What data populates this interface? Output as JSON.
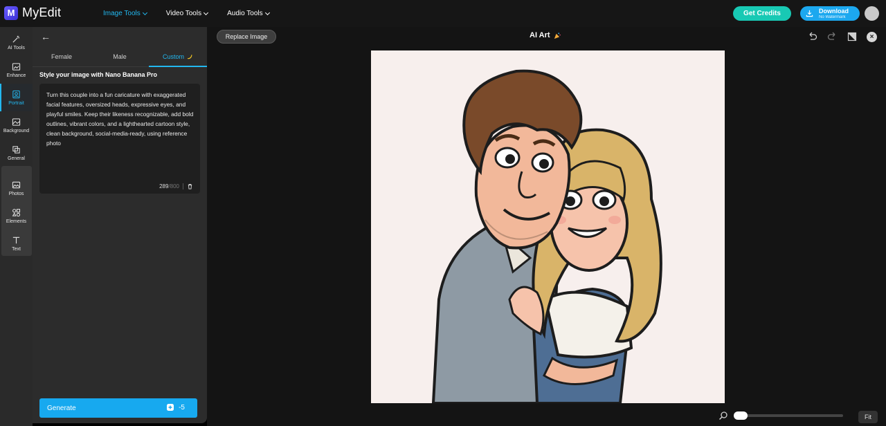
{
  "app": {
    "name": "MyEdit",
    "logo_letter": "M"
  },
  "nav": {
    "items": [
      {
        "label": "Image Tools",
        "active": true
      },
      {
        "label": "Video Tools",
        "active": false
      },
      {
        "label": "Audio Tools",
        "active": false
      }
    ]
  },
  "header": {
    "credits_label": "Get Credits",
    "download_label": "Download",
    "download_sublabel": "No Watermark"
  },
  "rail": {
    "items": [
      {
        "label": "AI Tools",
        "icon": "magic-wand-icon"
      },
      {
        "label": "Enhance",
        "icon": "enhance-icon"
      },
      {
        "label": "Portrait",
        "icon": "portrait-icon",
        "active": true
      },
      {
        "label": "Background",
        "icon": "background-icon"
      },
      {
        "label": "General",
        "icon": "general-icon"
      },
      {
        "label": "Photos",
        "icon": "photos-icon"
      },
      {
        "label": "Elements",
        "icon": "elements-icon"
      },
      {
        "label": "Text",
        "icon": "text-icon"
      }
    ]
  },
  "panel": {
    "tabs": [
      {
        "label": "Female"
      },
      {
        "label": "Male"
      },
      {
        "label": "Custom",
        "active": true
      }
    ],
    "section_title": "Style your image with Nano Banana Pro",
    "prompt": "Turn this couple into a fun caricature with exaggerated facial features, oversized heads, expressive eyes, and playful smiles. Keep their likeness recognizable, add bold outlines, vibrant colors, and a lighthearted cartoon style, clean background, social-media-ready, using reference photo",
    "char_count": "289",
    "char_max": "/800",
    "generate_label": "Generate",
    "generate_cost": "-5"
  },
  "canvas": {
    "replace_label": "Replace Image",
    "title": "AI Art",
    "fit_label": "Fit",
    "zoom_level": 0
  },
  "colors": {
    "accent": "#22b8f0",
    "credits": "#18c9b4",
    "download": "#1ca8ef",
    "generate": "#17a9ef"
  }
}
